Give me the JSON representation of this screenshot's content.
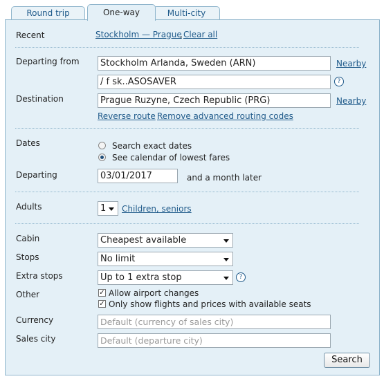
{
  "tabs": [
    "Round trip",
    "One-way",
    "Multi-city"
  ],
  "active_tab": "One-way",
  "recent": {
    "label": "Recent",
    "route_link": "Stockholm — Prague",
    "separator": ",",
    "clear_link": "Clear all"
  },
  "departing_from": {
    "label": "Departing from",
    "value": "Stockholm Arlanda, Sweden (ARN)",
    "nearby": "Nearby"
  },
  "routing_code": {
    "value": "/ f sk..ASOSAVER"
  },
  "destination": {
    "label": "Destination",
    "value": "Prague Ruzyne, Czech Republic (PRG)",
    "nearby": "Nearby"
  },
  "routing_links": {
    "reverse": "Reverse route",
    "remove": "Remove advanced routing codes"
  },
  "dates": {
    "label": "Dates",
    "option_exact": "Search exact dates",
    "option_calendar": "See calendar of lowest fares",
    "selected": "See calendar of lowest fares"
  },
  "departing": {
    "label": "Departing",
    "value": "03/01/2017",
    "suffix": "and a month later"
  },
  "adults": {
    "label": "Adults",
    "value": "1",
    "children_link": "Children, seniors"
  },
  "cabin": {
    "label": "Cabin",
    "value": "Cheapest available"
  },
  "stops": {
    "label": "Stops",
    "value": "No limit"
  },
  "extra_stops": {
    "label": "Extra stops",
    "value": "Up to 1 extra stop"
  },
  "other": {
    "label": "Other",
    "allow_airport_changes": {
      "label": "Allow airport changes",
      "checked": true
    },
    "only_available": {
      "label": "Only show flights and prices with available seats",
      "checked": true
    }
  },
  "currency": {
    "label": "Currency",
    "placeholder": "Default (currency of sales city)"
  },
  "sales_city": {
    "label": "Sales city",
    "placeholder": "Default (departure city)"
  },
  "search_button": "Search",
  "help_icon_glyph": "?",
  "check_glyph": "✓",
  "colors": {
    "panel_bg": "#e4f0f7",
    "border": "#8fb5cc",
    "link": "#1f5a8a"
  }
}
